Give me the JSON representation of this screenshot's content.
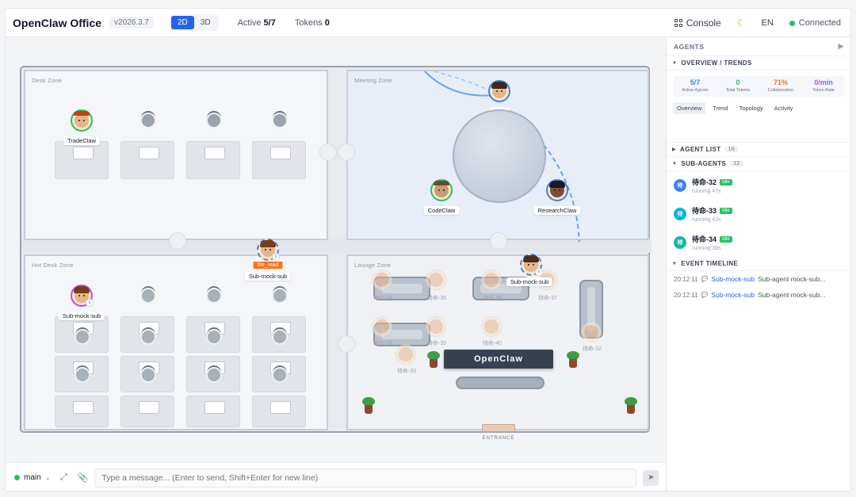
{
  "header": {
    "title": "OpenClaw Office",
    "version": "v2026.3.7",
    "view_2d": "2D",
    "view_3d": "3D",
    "active_label": "Active",
    "active_value": "5/7",
    "tokens_label": "Tokens",
    "tokens_value": "0",
    "console_label": "Console",
    "lang": "EN",
    "status": "Connected"
  },
  "office": {
    "zones": {
      "desk": "Desk Zone",
      "meeting": "Meeting Zone",
      "hotdesk": "Hot Desk Zone",
      "lounge": "Lounge Zone"
    },
    "agents": {
      "tradeclaw": "TradeClaw",
      "main": "main",
      "codeclaw": "CodeClaw",
      "researchclaw": "ResearchClaw",
      "submock_tool": "Sub-mock-sub",
      "submock_hot": "Sub-mock-sub",
      "submock_lounge": "Sub-mock-sub"
    },
    "tool_tag": "file_read",
    "ghosts": [
      "待命-34",
      "待命-35",
      "待命-36",
      "待命-37",
      "待命-38",
      "待命-39",
      "待命-40",
      "待命-32",
      "待命-33"
    ],
    "sign": "OpenClaw",
    "entrance": "ENTRANCE"
  },
  "chat": {
    "agent": "main",
    "placeholder": "Type a message... (Enter to send, Shift+Enter for new line)"
  },
  "sidebar": {
    "title": "AGENTS",
    "overview_title": "OVERVIEW / TRENDS",
    "metrics": [
      {
        "value": "5/7",
        "label": "Active Agents",
        "color": "#3b82f6"
      },
      {
        "value": "0",
        "label": "Total Tokens",
        "color": "#22c55e"
      },
      {
        "value": "71%",
        "label": "Collaboration",
        "color": "#f97316"
      },
      {
        "value": "0/min",
        "label": "Token Rate",
        "color": "#a855f7"
      }
    ],
    "tabs": [
      "Overview",
      "Trend",
      "Topology",
      "Activity"
    ],
    "agent_list_title": "AGENT LIST",
    "agent_list_count": "16",
    "subagents_title": "SUB-AGENTS",
    "subagents_count": "12",
    "subagents": [
      {
        "name": "待命-32",
        "status": "Idle",
        "meta": "running 47s",
        "color": "#3b82f6",
        "initial": "待"
      },
      {
        "name": "待命-33",
        "status": "Idle",
        "meta": "running 43s",
        "color": "#06b6d4",
        "initial": "待"
      },
      {
        "name": "待命-34",
        "status": "Idle",
        "meta": "running 38s",
        "color": "#14b8a6",
        "initial": "待"
      }
    ],
    "timeline_title": "EVENT TIMELINE",
    "events": [
      {
        "time": "20:12:11",
        "who": "Sub-mock-sub",
        "msg": "Sub-agent mock-sub..."
      },
      {
        "time": "20:12:11",
        "who": "Sub-mock-sub",
        "msg": "Sub-agent mock-sub..."
      }
    ]
  }
}
